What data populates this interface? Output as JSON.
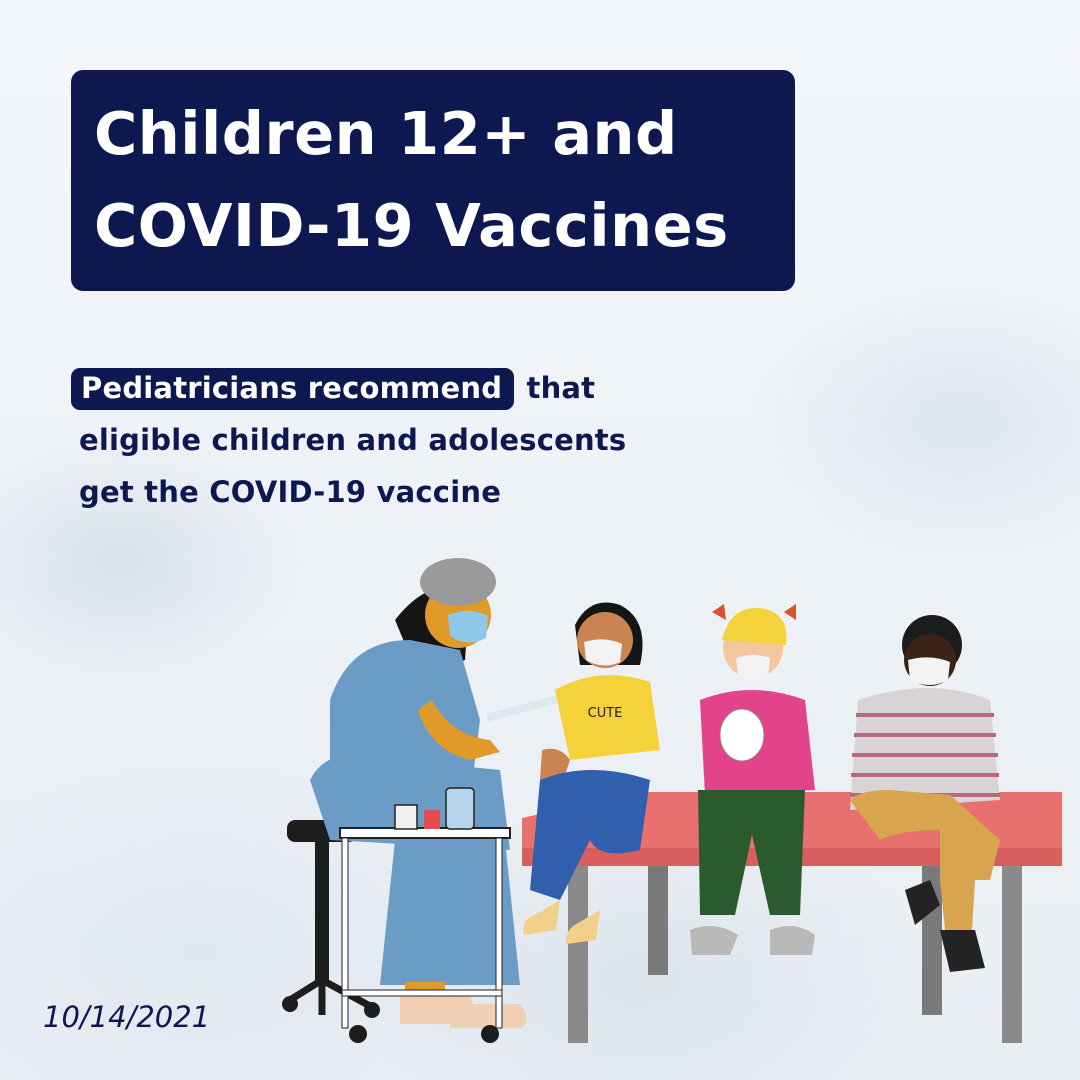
{
  "title": {
    "line1": "Children 12+ and",
    "line2": "COVID-19 Vaccines"
  },
  "subtitle": {
    "highlight": "Pediatricians recommend",
    "line1_rest": "that",
    "line2": "eligible children and adolescents",
    "line3": "get the COVID-19 vaccine"
  },
  "illustration": {
    "shirt_text": "CUTE"
  },
  "date": "10/14/2021",
  "colors": {
    "navy": "#0d1750",
    "table_top": "#e8706e",
    "nurse_uniform": "#6b9cc6",
    "shirt_yellow": "#f6d23a",
    "shirt_pink": "#e3438a"
  }
}
